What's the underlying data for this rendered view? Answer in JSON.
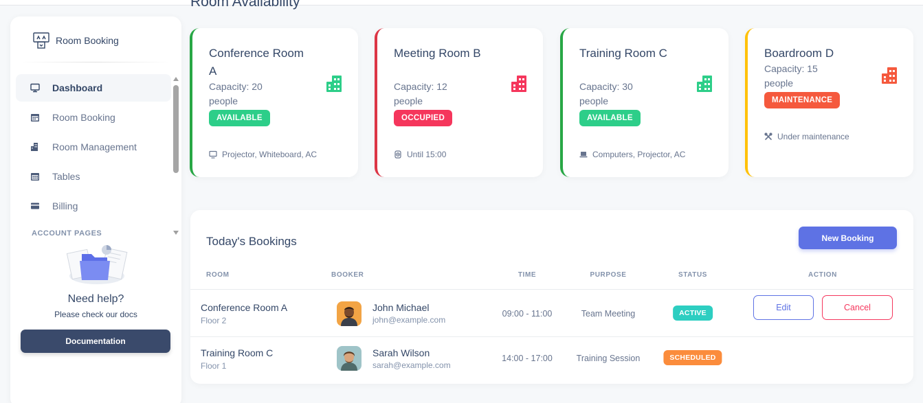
{
  "section_title": "Room Availability",
  "sidebar": {
    "brand": "Room Booking",
    "nav": [
      {
        "label": "Dashboard",
        "icon": "monitor-icon",
        "active": true
      },
      {
        "label": "Room Booking",
        "icon": "calendar-icon"
      },
      {
        "label": "Room Management",
        "icon": "building-icon"
      },
      {
        "label": "Tables",
        "icon": "table-icon"
      },
      {
        "label": "Billing",
        "icon": "credit-card-icon"
      }
    ],
    "section_label": "ACCOUNT PAGES",
    "help": {
      "title": "Need help?",
      "subtitle": "Please check our docs",
      "button": "Documentation"
    }
  },
  "rooms": [
    {
      "name": "Conference Room A",
      "capacity": "Capacity: 20 people",
      "status": "AVAILABLE",
      "feature_icon": "monitor-icon",
      "feature": "Projector, Whiteboard, AC",
      "color": "#2dce89"
    },
    {
      "name": "Meeting Room B",
      "capacity": "Capacity: 12 people",
      "status": "OCCUPIED",
      "feature_icon": "clock-icon",
      "feature": "Until 15:00",
      "color": "#f5365c"
    },
    {
      "name": "Training Room C",
      "capacity": "Capacity: 30 people",
      "status": "AVAILABLE",
      "feature_icon": "laptop-icon",
      "feature": "Computers, Projector, AC",
      "color": "#2dce89"
    },
    {
      "name": "Boardroom D",
      "capacity": "Capacity: 15 people",
      "status": "MAINTENANCE",
      "feature_icon": "tools-icon",
      "feature": "Under maintenance",
      "color": "#f5593d"
    }
  ],
  "bookings": {
    "title": "Today's Bookings",
    "new_button": "New Booking",
    "columns": [
      "ROOM",
      "BOOKER",
      "TIME",
      "PURPOSE",
      "STATUS",
      "ACTION"
    ],
    "rows": [
      {
        "room": "Conference Room A",
        "floor": "Floor 2",
        "booker": "John Michael",
        "email": "john@example.com",
        "time": "09:00 - 11:00",
        "purpose": "Team Meeting",
        "status": "ACTIVE",
        "actions": [
          "Edit",
          "Cancel"
        ]
      },
      {
        "room": "Training Room C",
        "floor": "Floor 1",
        "booker": "Sarah Wilson",
        "email": "sarah@example.com",
        "time": "14:00 - 17:00",
        "purpose": "Training Session",
        "status": "SCHEDULED",
        "actions": []
      }
    ]
  }
}
